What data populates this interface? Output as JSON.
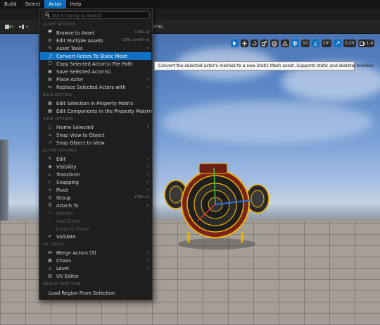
{
  "menubar": {
    "items": [
      "Build",
      "Select",
      "Actor",
      "Help"
    ],
    "active_index": 2
  },
  "toolbar": {
    "partial_text": "rms"
  },
  "viewport_tools": {
    "grid_snap": "10",
    "rotation_snap": "10°",
    "scale_snap": "0.25",
    "camera_speed": "1.4"
  },
  "menu": {
    "search_placeholder": "Start typing to search",
    "sections": {
      "asset_options": "ASSET OPTIONS",
      "bulk_editing": "BULK EDITING",
      "view_options": "VIEW OPTIONS",
      "actor_options": "ACTOR OPTIONS",
      "ue_tools": "UE TOOLS",
      "world_partition": "WORLD PARTITION"
    },
    "items": {
      "browse_to_asset": {
        "label": "Browse to Asset",
        "shortcut": "CTRL+B"
      },
      "edit_multiple_assets": {
        "label": "Edit Multiple Assets",
        "shortcut": "CTRL+SHIFT+E"
      },
      "asset_tools": {
        "label": "Asset Tools"
      },
      "convert_to_static_mesh": {
        "label": "Convert Actors To Static Mesh"
      },
      "copy_file_path": {
        "label": "Copy Selected Actor(s) File Path"
      },
      "save_selected": {
        "label": "Save Selected Actor(s)"
      },
      "place_actor": {
        "label": "Place Actor"
      },
      "replace_selected": {
        "label": "Replace Selected Actors with"
      },
      "edit_selection_matrix": {
        "label": "Edit Selection in Property Matrix"
      },
      "edit_components_matrix": {
        "label": "Edit Components in the Property Matrix"
      },
      "frame_selected": {
        "label": "Frame Selected",
        "shortcut": "F"
      },
      "snap_view_to_object": {
        "label": "Snap View to Object"
      },
      "snap_object_to_view": {
        "label": "Snap Object to View"
      },
      "edit": {
        "label": "Edit"
      },
      "visibility": {
        "label": "Visibility"
      },
      "transform": {
        "label": "Transform"
      },
      "snapping": {
        "label": "Snapping"
      },
      "pivot": {
        "label": "Pivot"
      },
      "group": {
        "label": "Group",
        "shortcut": "CTRL+G"
      },
      "attach_to": {
        "label": "Attach To"
      },
      "detach": {
        "label": "Detach"
      },
      "add_event": {
        "label": "Add Event"
      },
      "jump_to_event": {
        "label": "Jump to Event"
      },
      "validate": {
        "label": "Validate"
      },
      "merge_actors": {
        "label": "Merge Actors (3)"
      },
      "chaos": {
        "label": "Chaos"
      },
      "level": {
        "label": "Level"
      },
      "uv_editor": {
        "label": "UV Editor"
      },
      "load_region": {
        "label": "Load Region From Selection"
      }
    }
  },
  "tooltip": {
    "text": "Convert the selected actor's meshes to a new Static Mesh asset. Supports static and skeletal meshes."
  },
  "colors": {
    "accent": "#0e70c0",
    "menu_bg": "#1e1e1e",
    "selection_outline": "#f0b400"
  }
}
